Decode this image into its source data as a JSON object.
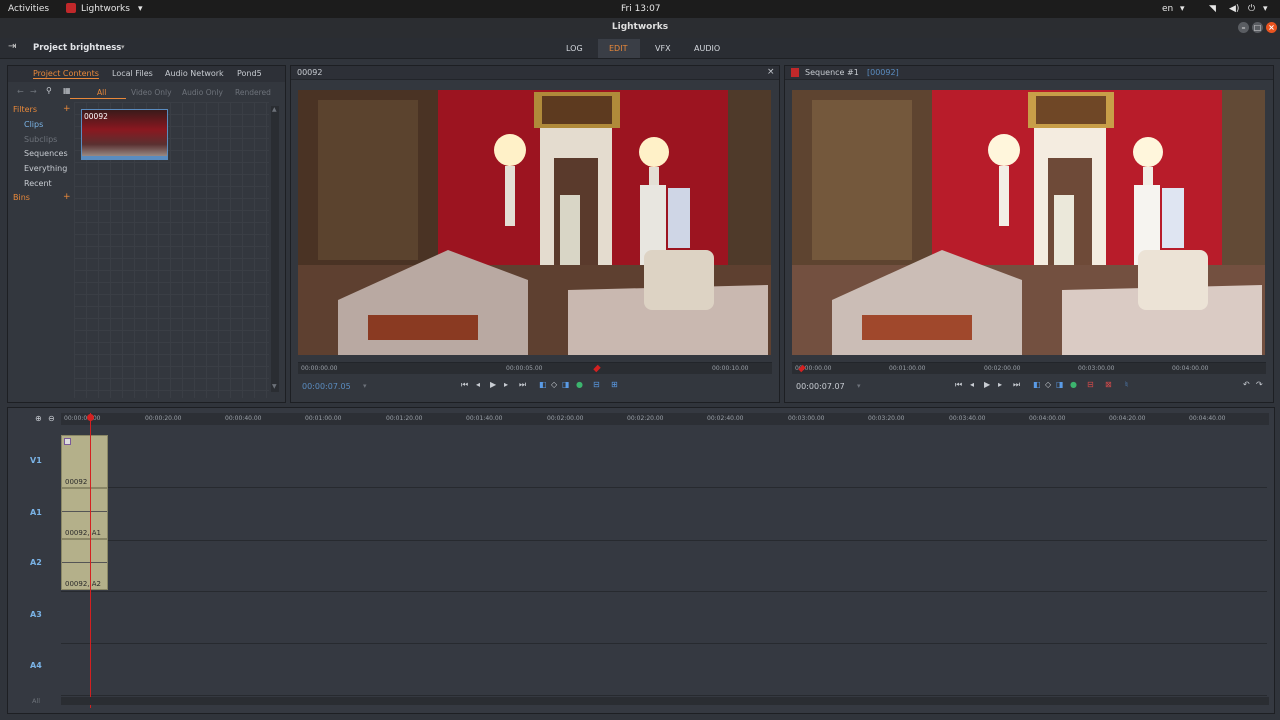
{
  "system_bar": {
    "activities": "Activities",
    "app_menu": "Lightworks",
    "clock": "Fri 13:07",
    "lang": "en"
  },
  "window": {
    "title": "Lightworks"
  },
  "project": {
    "name": "Project brightness"
  },
  "mode_tabs": {
    "log": "LOG",
    "edit": "EDIT",
    "vfx": "VFX",
    "audio": "AUDIO"
  },
  "content_panel": {
    "tabs": {
      "project_contents": "Project Contents",
      "local_files": "Local Files",
      "audio_network": "Audio Network",
      "pond5": "Pond5"
    },
    "filters_bar": {
      "all": "All",
      "video_only": "Video Only",
      "audio_only": "Audio Only",
      "rendered": "Rendered"
    },
    "filters_label": "Filters",
    "bins_label": "Bins",
    "filter_items": {
      "clips": "Clips",
      "subclips": "Subclips",
      "sequences": "Sequences",
      "everything": "Everything",
      "recent": "Recent"
    },
    "thumb_label": "00092"
  },
  "source_viewer": {
    "title": "00092",
    "ruler": {
      "t0": "00:00:00.00",
      "t1": "00:00:05.00",
      "t2": "00:00:10.00"
    },
    "playhead_fraction": 0.63,
    "timecode": "00:00:07.05"
  },
  "record_viewer": {
    "title": "Sequence #1",
    "title_ref": "[00092]",
    "ruler": {
      "t0": "00:00:00.00",
      "t1": "00:01:00.00",
      "t2": "00:02:00.00",
      "t3": "00:03:00.00",
      "t4": "00:04:00.00"
    },
    "timecode": "00:00:07.07"
  },
  "timeline": {
    "ruler": {
      "r0": "00:00:00.00",
      "r1": "00:00:20.00",
      "r2": "00:00:40.00",
      "r3": "00:01:00.00",
      "r4": "00:01:20.00",
      "r5": "00:01:40.00",
      "r6": "00:02:00.00",
      "r7": "00:02:20.00",
      "r8": "00:02:40.00",
      "r9": "00:03:00.00",
      "r10": "00:03:20.00",
      "r11": "00:03:40.00",
      "r12": "00:04:00.00",
      "r13": "00:04:20.00",
      "r14": "00:04:40.00"
    },
    "tracks": {
      "v1": "V1",
      "a1": "A1",
      "a2": "A2",
      "a3": "A3",
      "a4": "A4"
    },
    "clips": {
      "v1": "00092",
      "a1": "00092, A1",
      "a2": "00092, A2"
    },
    "all_label": "All"
  },
  "colors": {
    "accent": "#e8883a",
    "playhead": "#d42020",
    "track_label": "#7ab3e6",
    "clip": "#b4b08a"
  }
}
